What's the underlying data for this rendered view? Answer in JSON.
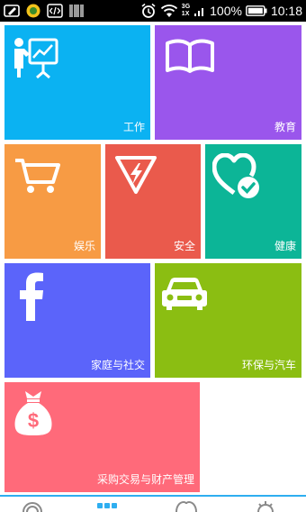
{
  "status_bar": {
    "battery": "100%",
    "time": "10:18",
    "net_3g": "3G",
    "net_1x": "1X"
  },
  "tiles": [
    {
      "label": "工作",
      "color": "#0bb2f2",
      "icon": "presenter-board-icon"
    },
    {
      "label": "教育",
      "color": "#9a56ec",
      "icon": "open-book-icon"
    },
    {
      "label": "娱乐",
      "color": "#f79b44",
      "icon": "shopping-cart-icon"
    },
    {
      "label": "安全",
      "color": "#ea5a4c",
      "icon": "warning-bolt-icon"
    },
    {
      "label": "健康",
      "color": "#0cb597",
      "icon": "heart-check-icon"
    },
    {
      "label": "家庭与社交",
      "color": "#5b64fa",
      "icon": "facebook-icon"
    },
    {
      "label": "环保与汽车",
      "color": "#8bbe12",
      "icon": "car-icon"
    },
    {
      "label": "采购交易与财产管理",
      "color": "#ff6a7a",
      "icon": "money-bag-icon"
    }
  ],
  "bottom_nav": {
    "accent": "#2eaef0",
    "items": [
      "radar-icon",
      "grid-icon",
      "heart-icon",
      "gear-icon"
    ]
  }
}
